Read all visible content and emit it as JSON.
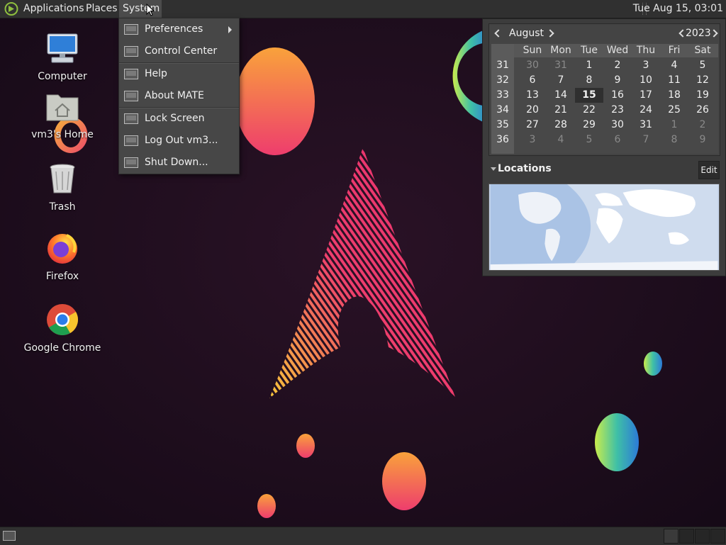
{
  "top_panel": {
    "menus": [
      "Applications",
      "Places",
      "System"
    ],
    "clock": "Tue Aug 15, 03:01"
  },
  "desktop_icons": [
    {
      "label": "Computer",
      "icon": "computer-icon"
    },
    {
      "label": "vm3's Home",
      "icon": "home-folder-icon"
    },
    {
      "label": "Trash",
      "icon": "trash-icon"
    },
    {
      "label": "Firefox",
      "icon": "firefox-icon"
    },
    {
      "label": "Google Chrome",
      "icon": "chrome-icon"
    }
  ],
  "system_menu": {
    "items": [
      {
        "label": "Preferences",
        "submenu": true
      },
      {
        "label": "Control Center"
      },
      {
        "label": "Help"
      },
      {
        "label": "About MATE"
      },
      {
        "label": "Lock Screen"
      },
      {
        "label": "Log Out vm3..."
      },
      {
        "label": "Shut Down..."
      }
    ]
  },
  "calendar": {
    "month": "August",
    "year": "2023",
    "weekdays": [
      "Sun",
      "Mon",
      "Tue",
      "Wed",
      "Thu",
      "Fri",
      "Sat"
    ],
    "weeks": [
      {
        "week": "31",
        "days": [
          "30",
          "31",
          "1",
          "2",
          "3",
          "4",
          "5"
        ]
      },
      {
        "week": "32",
        "days": [
          "6",
          "7",
          "8",
          "9",
          "10",
          "11",
          "12"
        ]
      },
      {
        "week": "33",
        "days": [
          "13",
          "14",
          "15",
          "16",
          "17",
          "18",
          "19"
        ]
      },
      {
        "week": "34",
        "days": [
          "20",
          "21",
          "22",
          "23",
          "24",
          "25",
          "26"
        ]
      },
      {
        "week": "35",
        "days": [
          "27",
          "28",
          "29",
          "30",
          "31",
          "1",
          "2"
        ]
      },
      {
        "week": "36",
        "days": [
          "3",
          "4",
          "5",
          "6",
          "7",
          "8",
          "9"
        ]
      }
    ],
    "today": "15",
    "locations_label": "Locations",
    "edit_label": "Edit"
  },
  "colors": {
    "panel": "#303030",
    "menu_bg": "#474747",
    "wallpaper": "#1b0d1d",
    "accent_pink": "#e8336d",
    "accent_orange": "#f8a23a"
  }
}
